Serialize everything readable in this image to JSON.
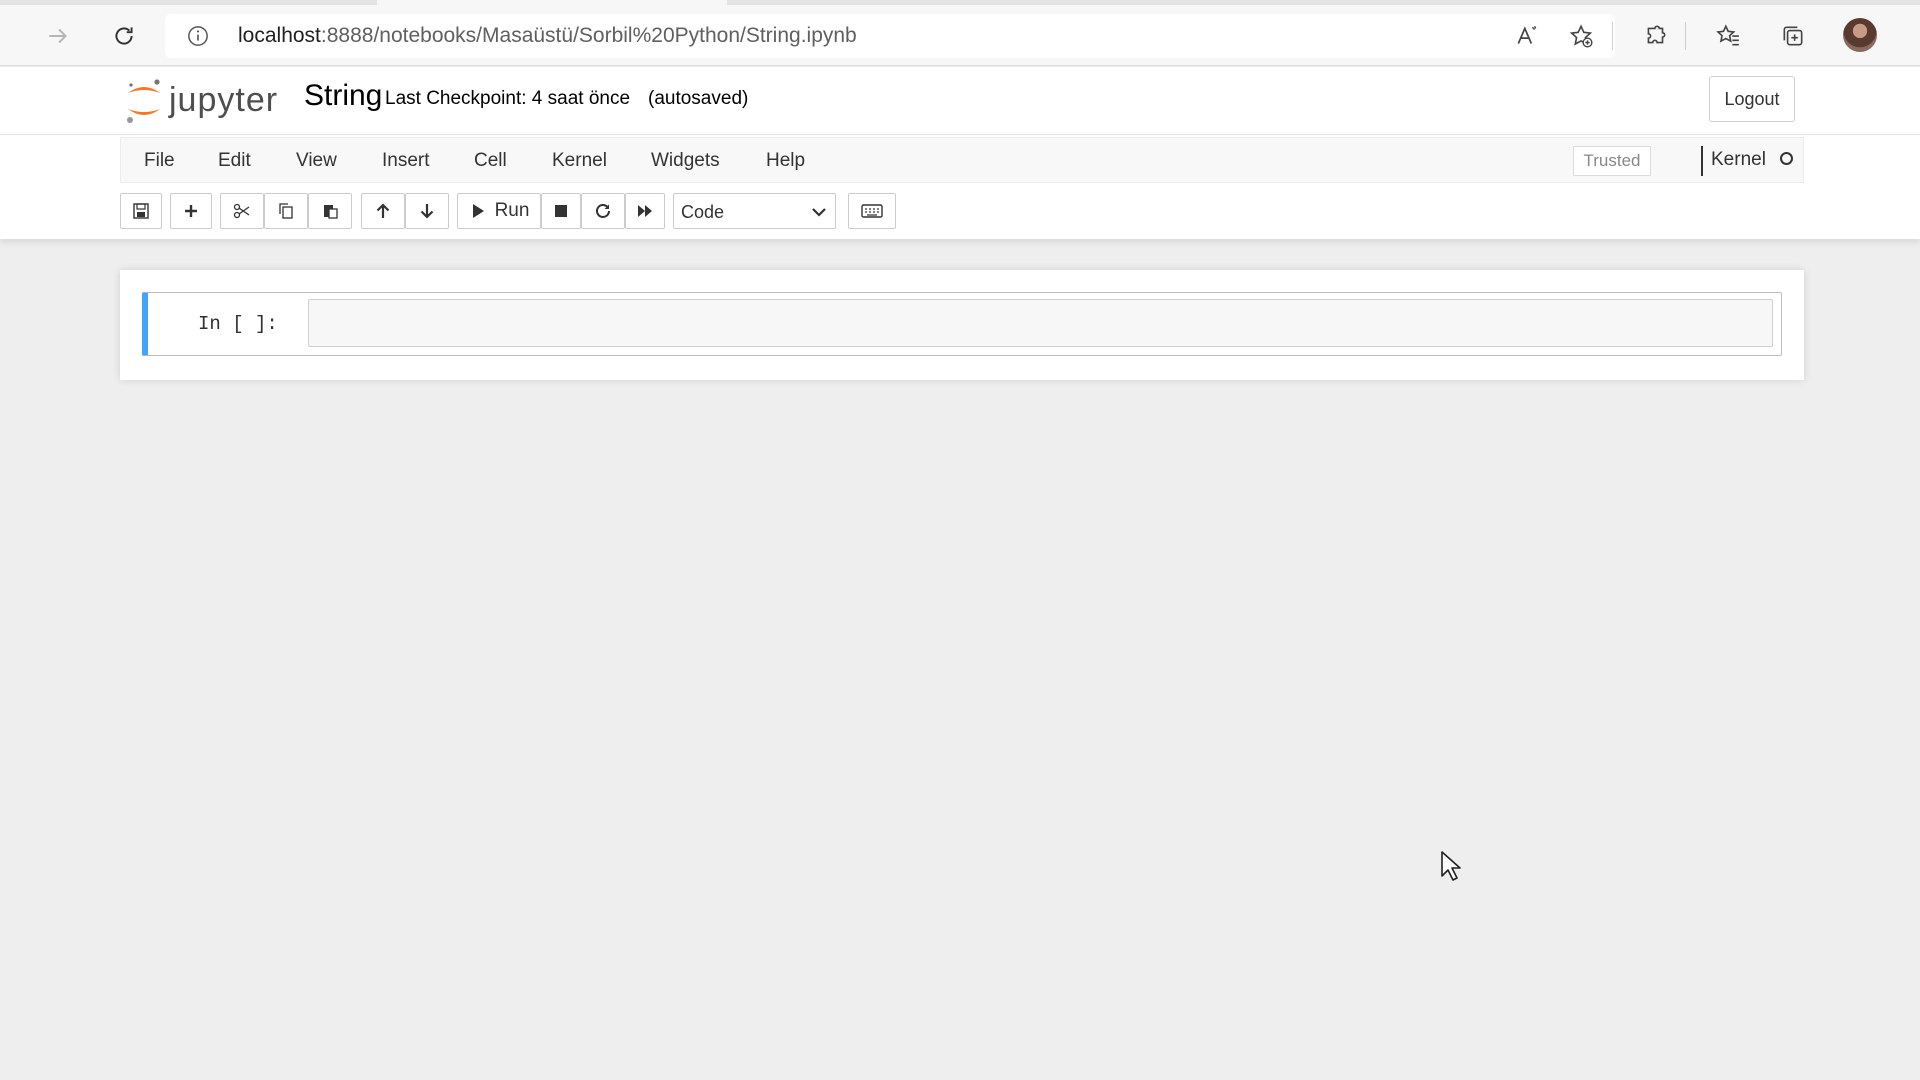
{
  "browser": {
    "url_host": "localhost",
    "url_rest": ":8888/notebooks/Masaüstü/Sorbil%20Python/String.ipynb"
  },
  "header": {
    "logo_text": "jupyter",
    "notebook_name": "String",
    "checkpoint": "Last Checkpoint: 4 saat önce",
    "autosave": "(autosaved)",
    "logout_label": "Logout"
  },
  "menubar": {
    "items": [
      "File",
      "Edit",
      "View",
      "Insert",
      "Cell",
      "Kernel",
      "Widgets",
      "Help"
    ],
    "trusted_label": "Trusted",
    "kernel_label": "Kernel"
  },
  "toolbar": {
    "run_label": "Run",
    "cell_type": "Code"
  },
  "cell": {
    "prompt": "In [ ]:",
    "code": ""
  },
  "colors": {
    "cell_selected_border": "#42a5f5",
    "jupyter_orange": "#f37726"
  }
}
